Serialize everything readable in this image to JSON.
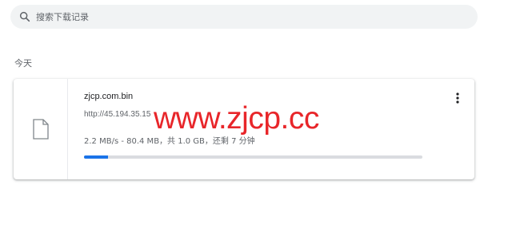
{
  "search": {
    "placeholder": "搜索下载记录",
    "icon": "search-icon"
  },
  "date_group": {
    "label": "今天"
  },
  "download": {
    "file_name": "zjcp.com.bin",
    "url": "http://45.194.35.15",
    "progress_text": "2.2 MB/s - 80.4 MB，共 1.0 GB，还剩 7 分钟",
    "progress_fraction": 0.07,
    "file_icon": "file-icon",
    "menu_icon": "more-vert-icon"
  },
  "watermark": {
    "text": "www.zjcp.cc",
    "color": "#e8262a"
  },
  "colors": {
    "accent": "#1a73e8",
    "track": "#dadce0",
    "search_bg": "#f1f3f4"
  }
}
